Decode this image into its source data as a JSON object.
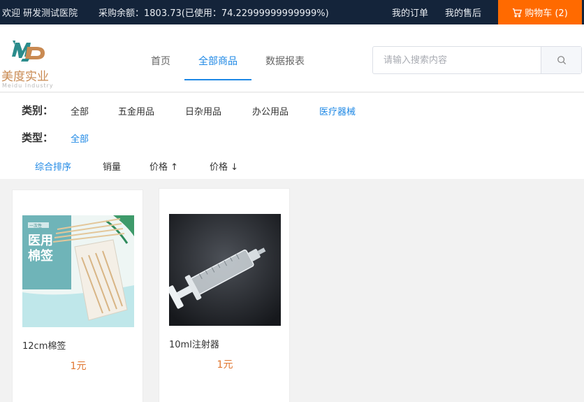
{
  "topbar": {
    "welcome": "欢迎 研发测试医院",
    "balance": "采购余额：1803.73(已使用：74.22999999999999%)",
    "my_orders": "我的订单",
    "my_aftersale": "我的售后",
    "cart_label": "购物车 (2)"
  },
  "logo": {
    "name": "美度实业",
    "sub": "Meidu Industry"
  },
  "nav": {
    "items": [
      {
        "label": "首页"
      },
      {
        "label": "全部商品"
      },
      {
        "label": "数据报表"
      }
    ],
    "active": "全部商品"
  },
  "search": {
    "placeholder": "请输入搜索内容"
  },
  "filters": {
    "category_label": "类别：",
    "category_options": [
      "全部",
      "五金用品",
      "日杂用品",
      "办公用品",
      "医疗器械"
    ],
    "category_active": "医疗器械",
    "type_label": "类型：",
    "type_options": [
      "全部"
    ],
    "type_active": "全部"
  },
  "sort": {
    "options": [
      "综合排序",
      "销量",
      "价格 ↑",
      "价格 ↓"
    ],
    "active": "综合排序"
  },
  "products": [
    {
      "name": "12cm棉签",
      "price": "1元"
    },
    {
      "name": "10ml注射器",
      "price": "1元"
    }
  ],
  "swab_packaging": {
    "line1": "医用",
    "line2": "棉签",
    "tag": "一次性"
  },
  "colors": {
    "topbar_bg": "#14243a",
    "cart_bg": "#ff6a00",
    "accent": "#1e88e5",
    "price": "#e0752e"
  }
}
